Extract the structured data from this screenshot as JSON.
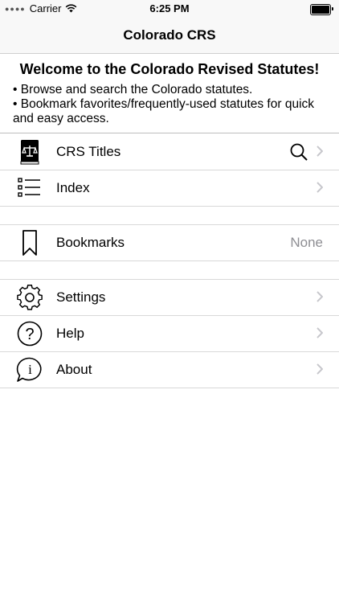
{
  "status_bar": {
    "carrier": "Carrier",
    "time": "6:25 PM"
  },
  "nav": {
    "title": "Colorado CRS"
  },
  "welcome": {
    "heading": "Welcome to the Colorado Revised Statutes!",
    "bullet1": "• Browse and search the Colorado statutes.",
    "bullet2": "• Bookmark favorites/frequently-used statutes for quick and easy access."
  },
  "menu": {
    "crs_titles": {
      "label": "CRS Titles",
      "icon": "law-book-icon"
    },
    "index": {
      "label": "Index",
      "icon": "list-icon"
    },
    "bookmarks": {
      "label": "Bookmarks",
      "value": "None",
      "icon": "bookmark-icon"
    },
    "settings": {
      "label": "Settings",
      "icon": "gear-icon"
    },
    "help": {
      "label": "Help",
      "icon": "question-icon"
    },
    "about": {
      "label": "About",
      "icon": "info-bubble-icon"
    }
  },
  "colors": {
    "chevron": "#c7c7cc",
    "secondary_text": "#8e8e93",
    "bar_background": "#f8f8f8"
  }
}
